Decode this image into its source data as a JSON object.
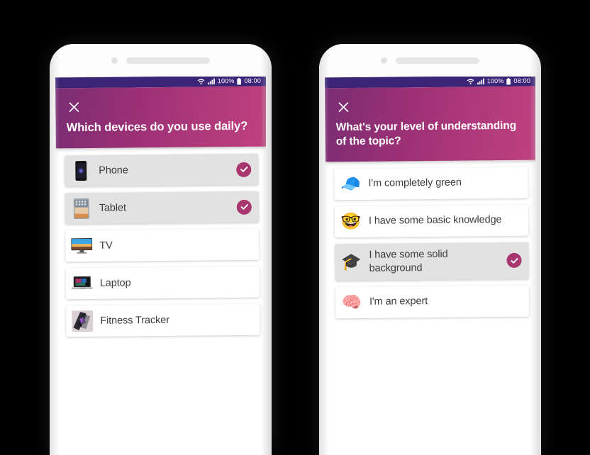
{
  "app": {
    "background_color": "#000000",
    "accent_color": "#a8366f",
    "statusbar_color": "#3c2477",
    "header_gradient_from": "#7a2d74",
    "header_gradient_to": "#c0407f"
  },
  "statusbar": {
    "wifi_icon": "wifi-icon",
    "signal_icon": "cellular-signal-icon",
    "battery_percent": "100%",
    "battery_icon": "battery-full-icon",
    "time": "08:00"
  },
  "phones": [
    {
      "name": "devices-survey-phone",
      "header": {
        "close_icon": "close-x-icon",
        "title": "Which devices do you use daily?"
      },
      "options": [
        {
          "label": "Phone",
          "icon": "smartphone-thumbnail",
          "selected": true,
          "emoji": ""
        },
        {
          "label": "Tablet",
          "icon": "tablet-thumbnail",
          "selected": true,
          "emoji": ""
        },
        {
          "label": "TV",
          "icon": "television-thumbnail",
          "selected": false,
          "emoji": ""
        },
        {
          "label": "Laptop",
          "icon": "laptop-thumbnail",
          "selected": false,
          "emoji": ""
        },
        {
          "label": "Fitness Tracker",
          "icon": "fitness-tracker-thumbnail",
          "selected": false,
          "emoji": ""
        }
      ]
    },
    {
      "name": "knowledge-level-survey-phone",
      "header": {
        "close_icon": "close-x-icon",
        "title": "What's your level of understanding of the topic?"
      },
      "options": [
        {
          "label": "I'm completely green",
          "icon": "blue-cap-emoji-icon",
          "selected": false,
          "emoji": "🧢"
        },
        {
          "label": "I have some basic knowledge",
          "icon": "nerd-face-emoji-icon",
          "selected": false,
          "emoji": "🤓"
        },
        {
          "label": "I have some solid background",
          "icon": "graduation-cap-emoji-icon",
          "selected": true,
          "emoji": "🎓"
        },
        {
          "label": "I'm an expert",
          "icon": "brain-emoji-icon",
          "selected": false,
          "emoji": "🧠"
        }
      ]
    }
  ],
  "checkmark_icon": "check-circle-icon"
}
